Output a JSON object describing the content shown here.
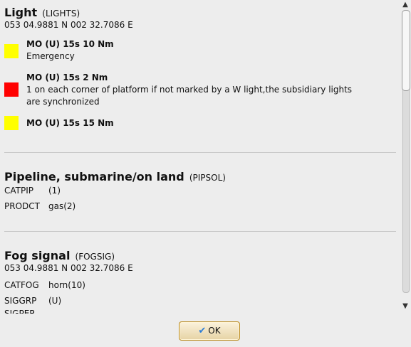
{
  "features": [
    {
      "title": "Light",
      "code": "(LIGHTS)",
      "position": "053 04.9881 N 002 32.7086 E",
      "lights": [
        {
          "color": "#ffff00",
          "title": "MO (U) 15s 10 Nm",
          "description": "Emergency"
        },
        {
          "color": "#ff0000",
          "title": "MO (U) 15s 2 Nm",
          "description": "1 on each corner of platform if not marked by a W light,the subsidiary lights are synchronized"
        },
        {
          "color": "#ffff00",
          "title": "MO (U) 15s 15 Nm",
          "description": ""
        }
      ]
    },
    {
      "title": "Pipeline, submarine/on land",
      "code": "(PIPSOL)",
      "attributes": [
        {
          "key": "CATPIP",
          "value": "(1)"
        },
        {
          "key": "PRODCT",
          "value": "gas(2)"
        }
      ]
    },
    {
      "title": "Fog signal",
      "code": "(FOGSIG)",
      "position": "053 04.9881 N 002 32.7086 E",
      "attributes": [
        {
          "key": "CATFOG",
          "value": "horn(10)"
        },
        {
          "key": "SIGGRP",
          "value": "(U)"
        },
        {
          "key": "SIGPER",
          "value": ""
        }
      ]
    }
  ],
  "scrollbar": {
    "up_icon": "arrow-up-icon",
    "down_icon": "arrow-down-icon"
  },
  "ok_button": {
    "label": "OK",
    "icon": "checkmark-icon"
  }
}
